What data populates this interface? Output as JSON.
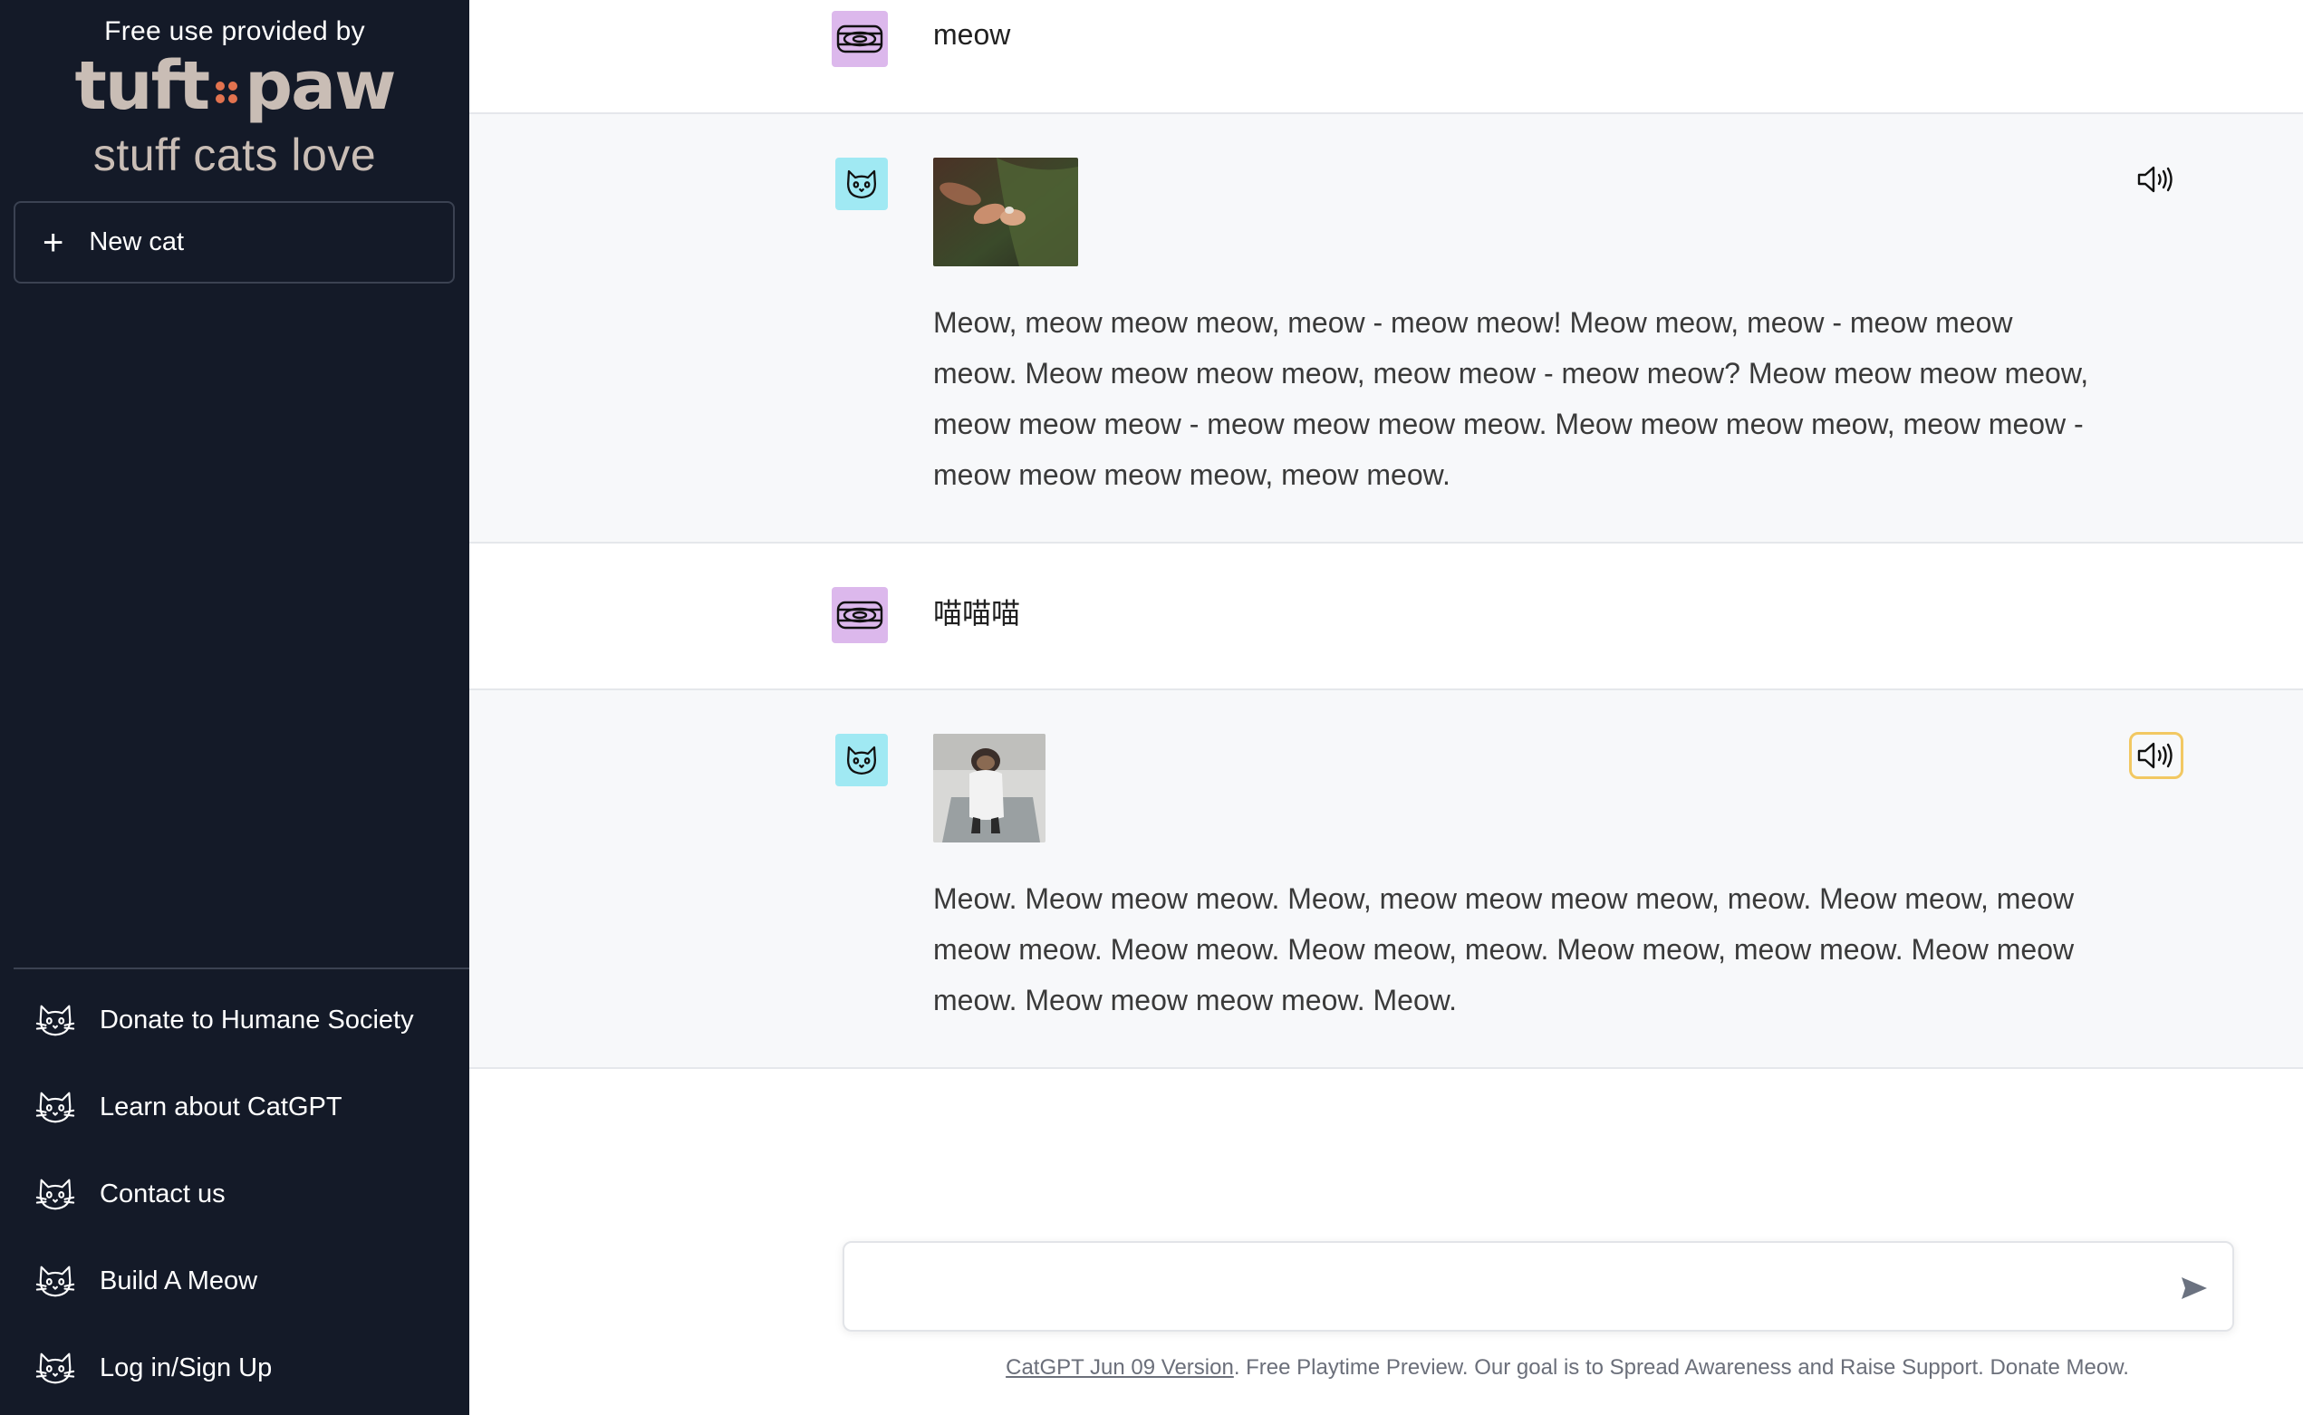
{
  "sidebar": {
    "sponsor_text": "Free use provided by",
    "logo_left": "tuft",
    "logo_right": "paw",
    "tagline": "stuff cats love",
    "new_cat_label": "New cat",
    "links": [
      {
        "label": "Donate to Humane Society",
        "icon": "cat-face-icon"
      },
      {
        "label": "Learn about CatGPT",
        "icon": "cat-face-icon"
      },
      {
        "label": "Contact us",
        "icon": "cat-face-icon"
      },
      {
        "label": "Build A Meow",
        "icon": "cat-face-icon"
      },
      {
        "label": "Log in/Sign Up",
        "icon": "cat-face-icon"
      }
    ]
  },
  "conversation": [
    {
      "role": "user",
      "text": "meow",
      "avatar": "cat-food-can-icon"
    },
    {
      "role": "assistant",
      "avatar": "cat-face-icon",
      "image": "cat-gif-thumbnail-1",
      "speaker": "speaker-icon",
      "text": "Meow, meow meow meow, meow - meow meow! Meow meow, meow - meow meow meow. Meow meow meow meow, meow meow - meow meow? Meow meow meow meow, meow meow meow - meow meow meow meow. Meow meow meow meow, meow meow - meow meow meow meow, meow meow."
    },
    {
      "role": "user",
      "text": "喵喵喵",
      "avatar": "cat-food-can-icon"
    },
    {
      "role": "assistant",
      "avatar": "cat-face-icon",
      "image": "cat-gif-thumbnail-2",
      "speaker": "speaker-icon",
      "text": "Meow. Meow meow meow. Meow, meow meow meow meow, meow. Meow meow, meow meow meow. Meow meow. Meow meow, meow. Meow meow, meow meow. Meow meow meow. Meow meow meow meow. Meow."
    }
  ],
  "composer": {
    "placeholder": "",
    "value": ""
  },
  "footer": {
    "version_link": "CatGPT Jun 09 Version",
    "text": ". Free Playtime Preview. Our goal is to Spread Awareness and Raise Support. Donate Meow."
  },
  "colors": {
    "sidebar_bg": "#141a28",
    "logo": "#c9bdb5",
    "logo_dots": "#e2734f",
    "user_avatar_bg": "#dcb8ec",
    "bot_avatar_bg": "#a0e9f3",
    "active_speaker_border": "#f2c862"
  }
}
